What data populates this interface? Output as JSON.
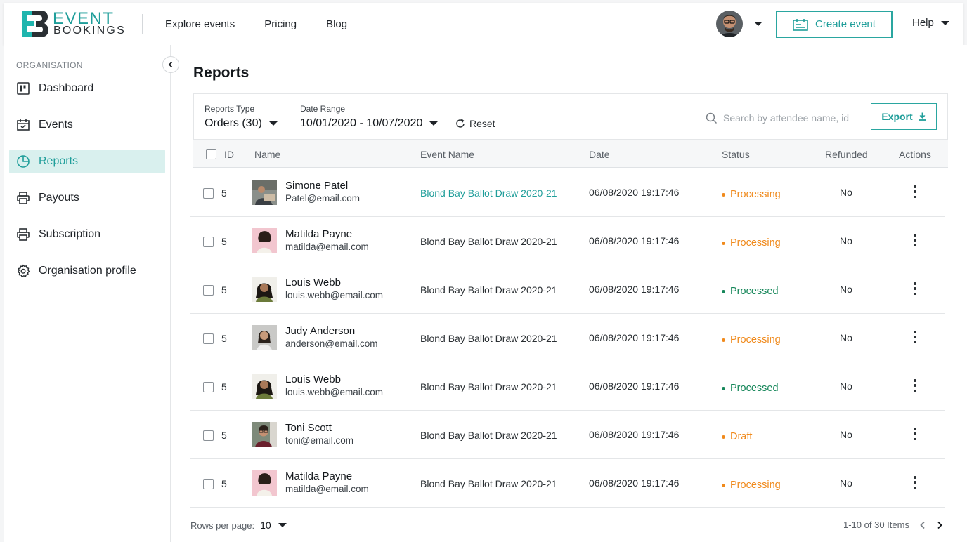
{
  "brand": {
    "logo_top": "EVENT",
    "logo_bottom": "BOOKINGS",
    "accent": "#1f9e9a"
  },
  "nav": {
    "items": [
      "Explore events",
      "Pricing",
      "Blog"
    ]
  },
  "header": {
    "create_label": "Create event",
    "help_label": "Help"
  },
  "sidebar": {
    "section": "ORGANISATION",
    "items": [
      {
        "label": "Dashboard",
        "icon": "dashboard-icon"
      },
      {
        "label": "Events",
        "icon": "calendar-icon"
      },
      {
        "label": "Reports",
        "icon": "pie-chart-icon",
        "active": true
      },
      {
        "label": "Payouts",
        "icon": "printer-icon"
      },
      {
        "label": "Subscription",
        "icon": "printer-icon"
      },
      {
        "label": "Organisation profile",
        "icon": "gear-icon"
      }
    ]
  },
  "page": {
    "title": "Reports"
  },
  "filters": {
    "type_label": "Reports Type",
    "type_value": "Orders (30)",
    "range_label": "Date Range",
    "range_value": "10/01/2020 - 10/07/2020",
    "reset_label": "Reset",
    "search_placeholder": "Search by attendee name, id",
    "export_label": "Export"
  },
  "table": {
    "columns": [
      "ID",
      "Name",
      "Event Name",
      "Date",
      "Status",
      "Refunded",
      "Actions"
    ],
    "status_colors": {
      "Processing": "#f08a1c",
      "Processed": "#16875a",
      "Draft": "#f08a1c"
    },
    "rows": [
      {
        "id": "5",
        "name": "Simone Patel",
        "email": "Patel@email.com",
        "event": "Blond Bay Ballot Draw 2020-21",
        "date": "06/08/2020 19:17:46",
        "status": "Processing",
        "refunded": "No"
      },
      {
        "id": "5",
        "name": "Matilda Payne",
        "email": "matilda@email.com",
        "event": "Blond Bay Ballot Draw 2020-21",
        "date": "06/08/2020 19:17:46",
        "status": "Processing",
        "refunded": "No"
      },
      {
        "id": "5",
        "name": "Louis Webb",
        "email": "louis.webb@email.com",
        "event": "Blond Bay Ballot Draw 2020-21",
        "date": "06/08/2020 19:17:46",
        "status": "Processed",
        "refunded": "No"
      },
      {
        "id": "5",
        "name": "Judy Anderson",
        "email": "anderson@email.com",
        "event": "Blond Bay Ballot Draw 2020-21",
        "date": "06/08/2020 19:17:46",
        "status": "Processing",
        "refunded": "No"
      },
      {
        "id": "5",
        "name": "Louis Webb",
        "email": "louis.webb@email.com",
        "event": "Blond Bay Ballot Draw 2020-21",
        "date": "06/08/2020 19:17:46",
        "status": "Processed",
        "refunded": "No"
      },
      {
        "id": "5",
        "name": "Toni Scott",
        "email": "toni@email.com",
        "event": "Blond Bay Ballot Draw 2020-21",
        "date": "06/08/2020 19:17:46",
        "status": "Draft",
        "refunded": "No"
      },
      {
        "id": "5",
        "name": "Matilda Payne",
        "email": "matilda@email.com",
        "event": "Blond Bay Ballot Draw 2020-21",
        "date": "06/08/2020 19:17:46",
        "status": "Processing",
        "refunded": "No"
      }
    ]
  },
  "pagination": {
    "rows_label": "Rows per page:",
    "rows_value": "10",
    "range_text": "1-10 of 30 Items"
  }
}
